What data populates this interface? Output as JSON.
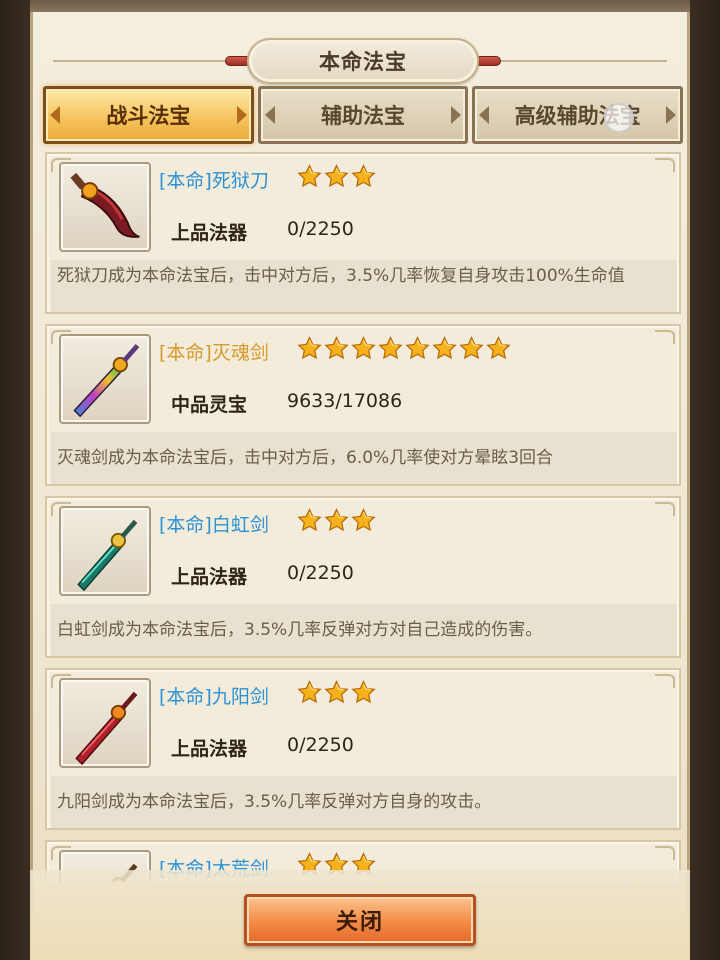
{
  "dialog": {
    "title": "本命法宝",
    "close_label": "关闭"
  },
  "tabs": [
    {
      "label": "战斗法宝",
      "active": true
    },
    {
      "label": "辅助法宝",
      "active": false
    },
    {
      "label": "高级辅助法宝",
      "active": false
    }
  ],
  "items": [
    {
      "name": "[本命]死狱刀",
      "name_color": "#2c92d6",
      "stars": 3,
      "grade": "上品法器",
      "progress": "0/2250",
      "description": "死狱刀成为本命法宝后，击中对方后，3.5%几率恢复自身攻击100%生命值",
      "icon": "dark-red-saber-icon"
    },
    {
      "name": "[本命]灭魂剑",
      "name_color": "#d69a2a",
      "stars": 8,
      "grade": "中品灵宝",
      "progress": "9633/17086",
      "description": "灭魂剑成为本命法宝后，击中对方后，6.0%几率使对方晕眩3回合",
      "icon": "rainbow-sword-icon"
    },
    {
      "name": "[本命]白虹剑",
      "name_color": "#2c92d6",
      "stars": 3,
      "grade": "上品法器",
      "progress": "0/2250",
      "description": "白虹剑成为本命法宝后，3.5%几率反弹对方对自己造成的伤害。",
      "icon": "jade-sword-icon"
    },
    {
      "name": "[本命]九阳剑",
      "name_color": "#2c92d6",
      "stars": 3,
      "grade": "上品法器",
      "progress": "0/2250",
      "description": "九阳剑成为本命法宝后，3.5%几率反弹对方自身的攻击。",
      "icon": "red-sword-icon"
    },
    {
      "name": "[本命]太荒剑",
      "name_color": "#2c92d6",
      "stars": 3,
      "grade": "",
      "progress": "",
      "description": "",
      "icon": "bronze-sword-icon"
    }
  ]
}
